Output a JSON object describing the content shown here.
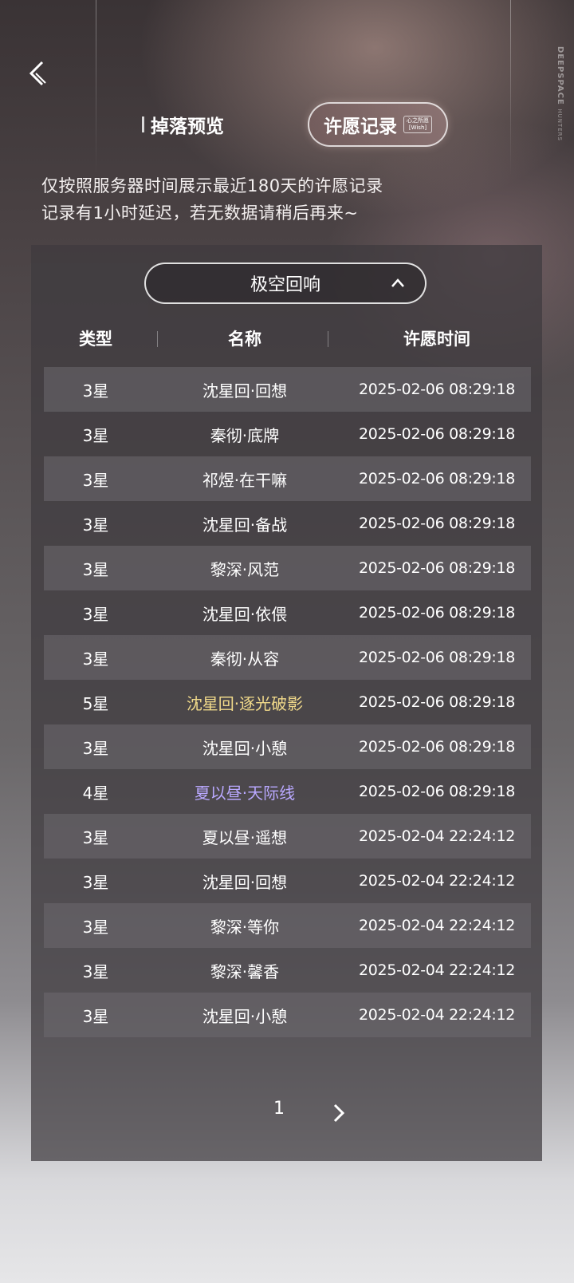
{
  "header": {
    "back_label": "",
    "brand_main": "DEEPSPACE",
    "brand_sub": "HUNTERS"
  },
  "tabs": {
    "drop_preview": "掉落预览",
    "wish_record": "许愿记录",
    "wish_tag_line1": "心之所愿",
    "wish_tag_line2": "[Wish]"
  },
  "notice": {
    "line1": "仅按照服务器时间展示最近180天的许愿记录",
    "line2": "记录有1小时延迟，若无数据请稍后再来~"
  },
  "filter": {
    "selected": "极空回响"
  },
  "table": {
    "headers": [
      "类型",
      "名称",
      "许愿时间"
    ],
    "rows": [
      {
        "type": "3星",
        "name": "沈星回·回想",
        "time": "2025-02-06 08:29:18",
        "rarity": "normal"
      },
      {
        "type": "3星",
        "name": "秦彻·底牌",
        "time": "2025-02-06 08:29:18",
        "rarity": "normal"
      },
      {
        "type": "3星",
        "name": "祁煜·在干嘛",
        "time": "2025-02-06 08:29:18",
        "rarity": "normal"
      },
      {
        "type": "3星",
        "name": "沈星回·备战",
        "time": "2025-02-06 08:29:18",
        "rarity": "normal"
      },
      {
        "type": "3星",
        "name": "黎深·风范",
        "time": "2025-02-06 08:29:18",
        "rarity": "normal"
      },
      {
        "type": "3星",
        "name": "沈星回·依偎",
        "time": "2025-02-06 08:29:18",
        "rarity": "normal"
      },
      {
        "type": "3星",
        "name": "秦彻·从容",
        "time": "2025-02-06 08:29:18",
        "rarity": "normal"
      },
      {
        "type": "5星",
        "name": "沈星回·逐光破影",
        "time": "2025-02-06 08:29:18",
        "rarity": "gold"
      },
      {
        "type": "3星",
        "name": "沈星回·小憩",
        "time": "2025-02-06 08:29:18",
        "rarity": "normal"
      },
      {
        "type": "4星",
        "name": "夏以昼·天际线",
        "time": "2025-02-06 08:29:18",
        "rarity": "purple"
      },
      {
        "type": "3星",
        "name": "夏以昼·遥想",
        "time": "2025-02-04 22:24:12",
        "rarity": "normal"
      },
      {
        "type": "3星",
        "name": "沈星回·回想",
        "time": "2025-02-04 22:24:12",
        "rarity": "normal"
      },
      {
        "type": "3星",
        "name": "黎深·等你",
        "time": "2025-02-04 22:24:12",
        "rarity": "normal"
      },
      {
        "type": "3星",
        "name": "黎深·馨香",
        "time": "2025-02-04 22:24:12",
        "rarity": "normal"
      },
      {
        "type": "3星",
        "name": "沈星回·小憩",
        "time": "2025-02-04 22:24:12",
        "rarity": "normal"
      }
    ]
  },
  "pagination": {
    "current_page": "1"
  },
  "colors": {
    "gold": "#f0d98a",
    "purple": "#b9a8ff"
  },
  "icons": {
    "back": "back-chevron-icon",
    "dropdown": "chevron-up-icon",
    "next": "chevron-right-icon"
  }
}
